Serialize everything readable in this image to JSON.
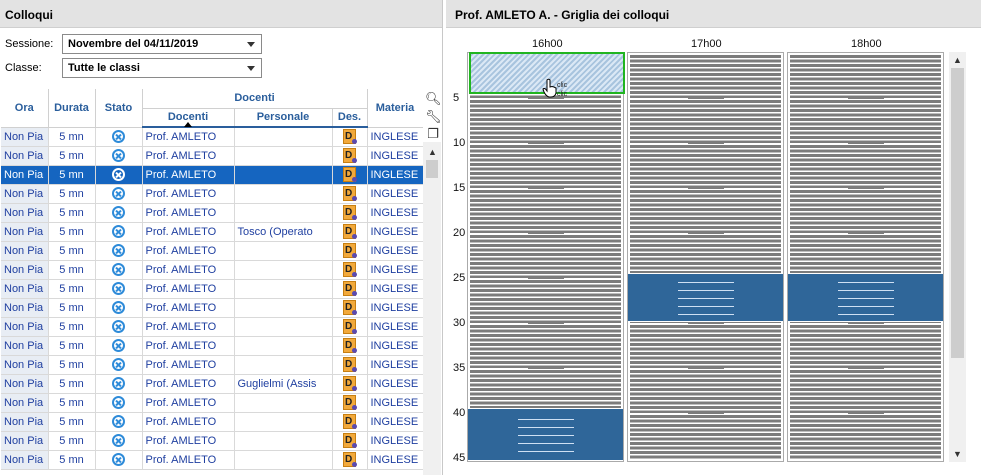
{
  "left_panel": {
    "title": "Colloqui",
    "sessione_label": "Sessione:",
    "sessione_value": "Novembre del 04/11/2019",
    "classe_label": "Classe:",
    "classe_value": "Tutte le classi",
    "columns": {
      "ora": "Ora",
      "durata": "Durata",
      "stato": "Stato",
      "docenti_group": "Docenti",
      "docenti": "Docenti",
      "personale": "Personale",
      "des": "Des.",
      "materia": "Materia"
    },
    "rows": [
      {
        "ora": "Non Pia",
        "durata": "5 mn",
        "docente": "Prof. AMLETO",
        "personale": "",
        "materia": "INGLESE"
      },
      {
        "ora": "Non Pia",
        "durata": "5 mn",
        "docente": "Prof. AMLETO",
        "personale": "",
        "materia": "INGLESE"
      },
      {
        "ora": "Non Pia",
        "durata": "5 mn",
        "docente": "Prof. AMLETO",
        "personale": "",
        "materia": "INGLESE",
        "selected": true
      },
      {
        "ora": "Non Pia",
        "durata": "5 mn",
        "docente": "Prof. AMLETO",
        "personale": "",
        "materia": "INGLESE"
      },
      {
        "ora": "Non Pia",
        "durata": "5 mn",
        "docente": "Prof. AMLETO",
        "personale": "",
        "materia": "INGLESE"
      },
      {
        "ora": "Non Pia",
        "durata": "5 mn",
        "docente": "Prof. AMLETO",
        "personale": "Tosco (Operato",
        "materia": "INGLESE"
      },
      {
        "ora": "Non Pia",
        "durata": "5 mn",
        "docente": "Prof. AMLETO",
        "personale": "",
        "materia": "INGLESE"
      },
      {
        "ora": "Non Pia",
        "durata": "5 mn",
        "docente": "Prof. AMLETO",
        "personale": "",
        "materia": "INGLESE"
      },
      {
        "ora": "Non Pia",
        "durata": "5 mn",
        "docente": "Prof. AMLETO",
        "personale": "",
        "materia": "INGLESE"
      },
      {
        "ora": "Non Pia",
        "durata": "5 mn",
        "docente": "Prof. AMLETO",
        "personale": "",
        "materia": "INGLESE"
      },
      {
        "ora": "Non Pia",
        "durata": "5 mn",
        "docente": "Prof. AMLETO",
        "personale": "",
        "materia": "INGLESE"
      },
      {
        "ora": "Non Pia",
        "durata": "5 mn",
        "docente": "Prof. AMLETO",
        "personale": "",
        "materia": "INGLESE"
      },
      {
        "ora": "Non Pia",
        "durata": "5 mn",
        "docente": "Prof. AMLETO",
        "personale": "",
        "materia": "INGLESE"
      },
      {
        "ora": "Non Pia",
        "durata": "5 mn",
        "docente": "Prof. AMLETO",
        "personale": "Guglielmi (Assis",
        "materia": "INGLESE"
      },
      {
        "ora": "Non Pia",
        "durata": "5 mn",
        "docente": "Prof. AMLETO",
        "personale": "",
        "materia": "INGLESE"
      },
      {
        "ora": "Non Pia",
        "durata": "5 mn",
        "docente": "Prof. AMLETO",
        "personale": "",
        "materia": "INGLESE"
      },
      {
        "ora": "Non Pia",
        "durata": "5 mn",
        "docente": "Prof. AMLETO",
        "personale": "",
        "materia": "INGLESE"
      },
      {
        "ora": "Non Pia",
        "durata": "5 mn",
        "docente": "Prof. AMLETO",
        "personale": "",
        "materia": "INGLESE"
      }
    ],
    "des_glyph": "D"
  },
  "right_panel": {
    "title": "Prof. AMLETO A. - Griglia dei colloqui",
    "hours": [
      "16h00",
      "17h00",
      "18h00"
    ],
    "minute_labels": [
      "5",
      "10",
      "15",
      "20",
      "25",
      "30",
      "35",
      "40",
      "45"
    ],
    "cursor_text": [
      "clic",
      "clic"
    ]
  },
  "colors": {
    "accent": "#2a5e9c",
    "selected_row": "#1565c0",
    "booked_block": "#2f6699",
    "selection_border": "#21b520"
  }
}
